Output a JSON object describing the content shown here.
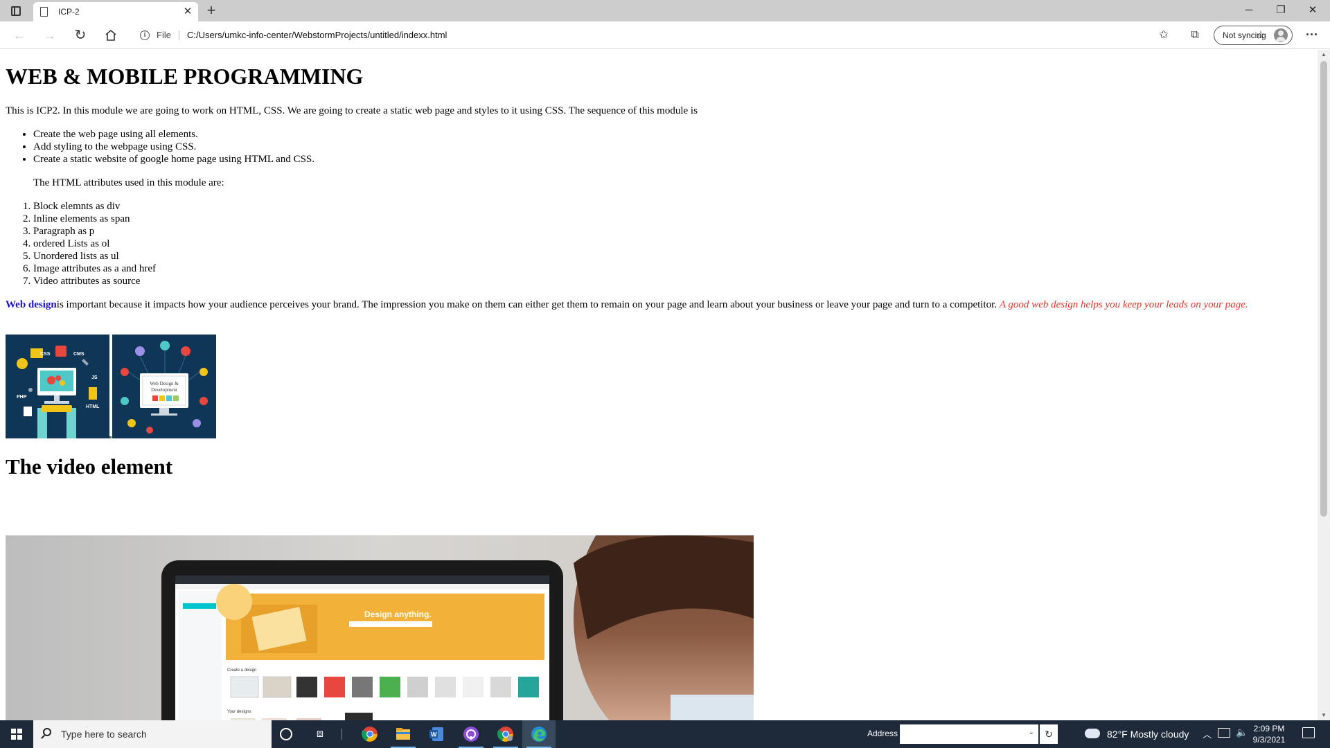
{
  "browser": {
    "tab_title": "ICP-2",
    "file_label": "File",
    "url": "C:/Users/umkc-info-center/WebstormProjects/untitled/indexx.html",
    "profile_label": "Not syncing",
    "icons": [
      "tab-actions-icon",
      "page-icon",
      "close-icon",
      "plus-icon",
      "back-icon",
      "forward-icon",
      "refresh-icon",
      "home-icon",
      "info-icon",
      "add-favorite-icon",
      "favorites-icon",
      "collections-icon",
      "avatar-icon",
      "more-icon"
    ]
  },
  "page": {
    "heading": "WEB & MOBILE PROGRAMMING",
    "intro": "This is ICP2. In this module we are going to work on HTML, CSS. We are going to create a static web page and styles to it using CSS. The sequence of this module is",
    "sequence_items": [
      "Create the web page using all elements.",
      "Add styling to the webpage using CSS.",
      "Create a static website of google home page using HTML and CSS."
    ],
    "attributes_intro": "The HTML attributes used in this module are:",
    "attribute_items": [
      "Block elemnts as div",
      "Inline elements as span",
      "Paragraph as p",
      "ordered Lists as ol",
      "Unordered lists as ul",
      "Image attributes as a and href",
      "Video attributes as source"
    ],
    "design_link": "Web design",
    "design_text": "is important because it impacts how your audience perceives your brand. The impression you make on them can either get them to remain on your page and learn about your business or leave your page and turn to a competitor.",
    "design_emphasis": "A good web design helps you keep your leads on your page.",
    "emphasis_color": "#e8322a",
    "link_color": "#1a0dcc",
    "image1_labels": [
      "CSS",
      "CMS",
      "JS",
      "PHP",
      "HTML"
    ],
    "image2_caption": [
      "Web Design &",
      "Development"
    ],
    "video_heading": "The video element",
    "video_frame_text": {
      "banner": "Design anything.",
      "section": "Create a design",
      "recent": "Your designs"
    }
  },
  "taskbar": {
    "search_placeholder": "Type here to search",
    "address_label": "Address",
    "weather": "82°F  Mostly cloudy",
    "time": "2:09 PM",
    "date": "9/3/2021",
    "icons": [
      "windows-start-icon",
      "search-icon",
      "cortana-icon",
      "task-view-icon",
      "chrome-icon",
      "file-explorer-icon",
      "word-icon",
      "github-desktop-icon",
      "chrome-icon",
      "edge-icon",
      "weather-icon",
      "network-icon",
      "volume-icon",
      "notifications-icon"
    ]
  }
}
